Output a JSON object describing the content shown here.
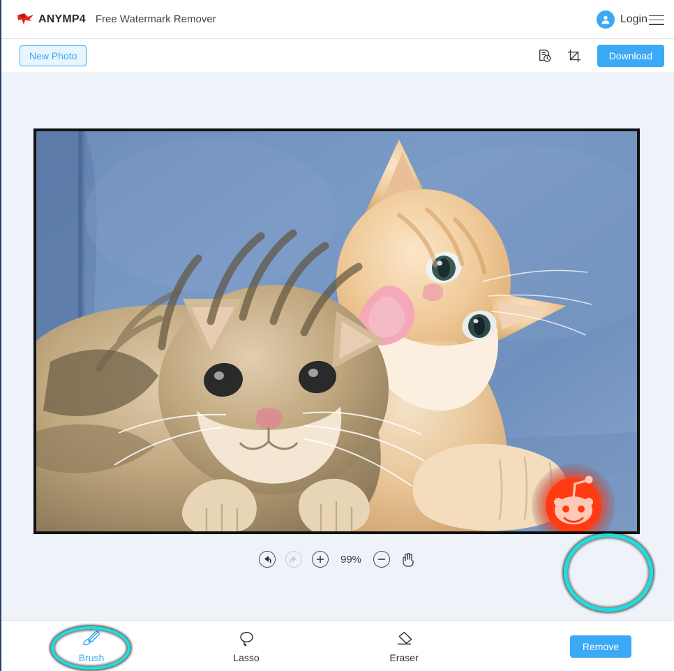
{
  "header": {
    "brand_name": "ANYMP4",
    "product_title": "Free Watermark Remover",
    "logo_icon": "anymp4-bird-logo",
    "avatar_icon": "user-avatar-icon",
    "login_label": "Login",
    "menu_icon": "hamburger-menu-icon",
    "logo_color": "#e02b20",
    "accent_color": "#3ba9f5"
  },
  "toolbar": {
    "new_photo_label": "New Photo",
    "history_icon": "history-icon",
    "crop_icon": "crop-icon",
    "download_label": "Download"
  },
  "canvas": {
    "background_color": "#eef3fa",
    "photo_alt": "Two cats on blue fabric, ginger kitten licking tabby cat",
    "watermark": {
      "name": "reddit-logo-watermark",
      "color": "#ff3b14",
      "highlight_color": "#17e0e0",
      "selected": true
    }
  },
  "zoom": {
    "undo_icon": "undo-icon",
    "redo_icon": "redo-icon",
    "redo_disabled": true,
    "zoom_in_icon": "zoom-in-icon",
    "zoom_out_icon": "zoom-out-icon",
    "hand_icon": "hand-pan-icon",
    "level": "99%"
  },
  "tools": [
    {
      "id": "brush",
      "label": "Brush",
      "icon": "paintbrush-icon",
      "active": true
    },
    {
      "id": "lasso",
      "label": "Lasso",
      "icon": "lasso-icon",
      "active": false
    },
    {
      "id": "eraser",
      "label": "Eraser",
      "icon": "eraser-icon",
      "active": false
    }
  ],
  "actions": {
    "remove_label": "Remove"
  }
}
